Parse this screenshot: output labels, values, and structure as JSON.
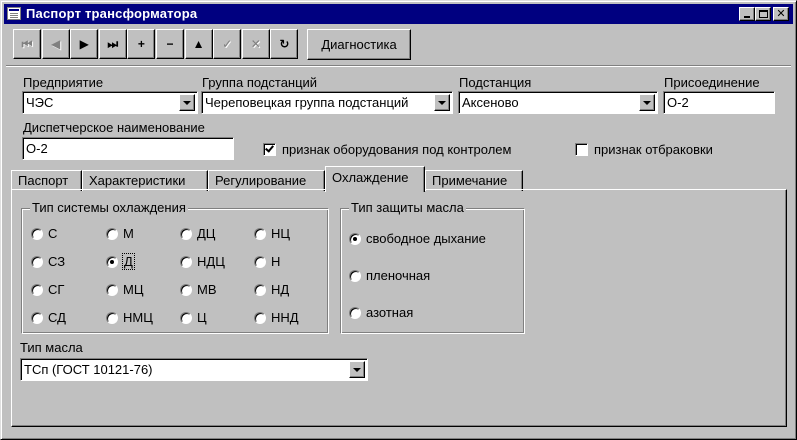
{
  "window": {
    "title": "Паспорт трансформатора"
  },
  "toolbar": {
    "diagnostics_label": "Диагностика",
    "nav_buttons": [
      {
        "icon": "first-record-icon",
        "glyph": "⏮",
        "enabled": false
      },
      {
        "icon": "prior-record-icon",
        "glyph": "◀",
        "enabled": false
      },
      {
        "icon": "next-record-icon",
        "glyph": "▶",
        "enabled": true
      },
      {
        "icon": "last-record-icon",
        "glyph": "⏭",
        "enabled": true
      },
      {
        "icon": "insert-record-icon",
        "glyph": "+",
        "enabled": true
      },
      {
        "icon": "delete-record-icon",
        "glyph": "−",
        "enabled": true
      },
      {
        "icon": "edit-record-icon",
        "glyph": "▲",
        "enabled": true
      },
      {
        "icon": "post-record-icon",
        "glyph": "✓",
        "enabled": false
      },
      {
        "icon": "cancel-record-icon",
        "glyph": "✕",
        "enabled": false
      },
      {
        "icon": "refresh-icon",
        "glyph": "↻",
        "enabled": true
      }
    ]
  },
  "form": {
    "enterprise_label": "Предприятие",
    "enterprise_value": "ЧЭС",
    "substation_group_label": "Группа подстанций",
    "substation_group_value": "Череповецкая группа подстанций",
    "substation_label": "Подстанция",
    "substation_value": "Аксеново",
    "connection_label": "Присоединение",
    "connection_value": "О-2",
    "dispatch_name_label": "Диспетчерское наименование",
    "dispatch_name_value": "О-2",
    "monitored_label": "признак оборудования под контролем",
    "monitored_checked": true,
    "rejected_label": "признак отбраковки",
    "rejected_checked": false
  },
  "tabs": [
    {
      "label": "Паспорт"
    },
    {
      "label": "Характеристики"
    },
    {
      "label": "Регулирование"
    },
    {
      "label": "Охлаждение",
      "active": true
    },
    {
      "label": "Примечание"
    }
  ],
  "cooling": {
    "system_type_title": "Тип системы охлаждения",
    "system_types": [
      {
        "label": "С",
        "selected": false
      },
      {
        "label": "М",
        "selected": false
      },
      {
        "label": "ДЦ",
        "selected": false
      },
      {
        "label": "НЦ",
        "selected": false
      },
      {
        "label": "СЗ",
        "selected": false
      },
      {
        "label": "Д",
        "selected": true
      },
      {
        "label": "НДЦ",
        "selected": false
      },
      {
        "label": "Н",
        "selected": false
      },
      {
        "label": "СГ",
        "selected": false
      },
      {
        "label": "МЦ",
        "selected": false
      },
      {
        "label": "МВ",
        "selected": false
      },
      {
        "label": "НД",
        "selected": false
      },
      {
        "label": "СД",
        "selected": false
      },
      {
        "label": "НМЦ",
        "selected": false
      },
      {
        "label": "Ц",
        "selected": false
      },
      {
        "label": "ННД",
        "selected": false
      }
    ],
    "oil_protection_title": "Тип защиты масла",
    "oil_protection": [
      {
        "label": "свободное дыхание",
        "selected": true
      },
      {
        "label": "пленочная",
        "selected": false
      },
      {
        "label": "азотная",
        "selected": false
      }
    ],
    "oil_type_label": "Тип масла",
    "oil_type_value": "ТСп (ГОСТ 10121-76)"
  },
  "colors": {
    "titlebar": "#000080",
    "face": "#c0c0c0",
    "field": "#ffffff"
  }
}
